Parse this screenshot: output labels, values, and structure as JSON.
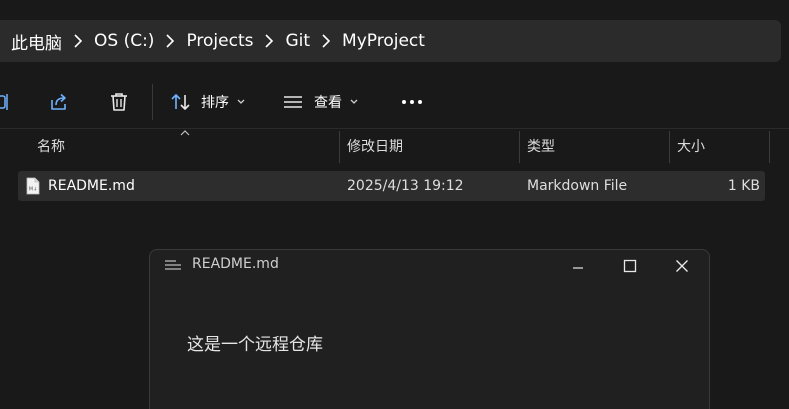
{
  "breadcrumb": [
    "此电脑",
    "OS (C:)",
    "Projects",
    "Git",
    "MyProject"
  ],
  "toolbar": {
    "sort_label": "排序",
    "view_label": "查看"
  },
  "columns": {
    "name": "名称",
    "modified": "修改日期",
    "type": "类型",
    "size": "大小"
  },
  "files": [
    {
      "name": "README.md",
      "modified": "2025/4/13 19:12",
      "type": "Markdown File",
      "size": "1 KB"
    }
  ],
  "notepad": {
    "title": "README.md",
    "content": "这是一个远程仓库"
  },
  "colors": {
    "background": "#191919",
    "addressbar": "#2b2b2b",
    "selected_row": "#2d2d2d",
    "notepad_bg": "#202020"
  }
}
